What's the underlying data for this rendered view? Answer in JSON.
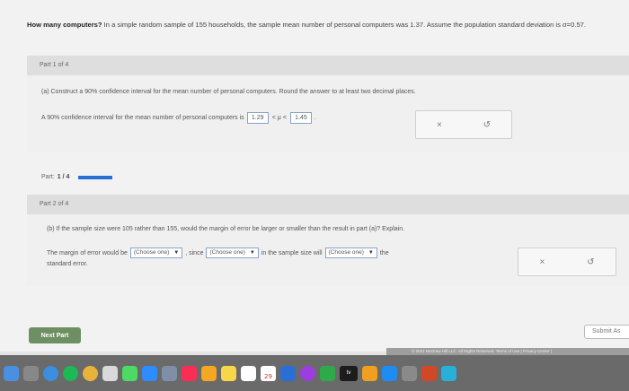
{
  "question": {
    "lead": "How many computers?",
    "body": " In a simple random sample of 155 households, the sample mean number of personal computers was 1.37. Assume the population standard deviation is σ=0.57."
  },
  "part1": {
    "header": "Part 1 of 4",
    "question": "(a) Construct a 90% confidence interval for the mean number of personal computers. Round the answer to at least two decimal places.",
    "answer_prefix": "A 90% confidence interval for the mean number of personal computers is",
    "lower": "1.29",
    "lt1": "<",
    "mu": "μ",
    "lt2": "<",
    "upper": "1.45",
    "period": "."
  },
  "tools": {
    "clear": "×",
    "undo": "↺"
  },
  "progress": {
    "label": "Part:",
    "value": "1 / 4",
    "fraction": 0.25
  },
  "part2": {
    "header": "Part 2 of 4",
    "question": "(b) If the sample size were 105 rather than 155, would the margin of error be larger or smaller than the result in part (a)? Explain.",
    "sentence_a": "The margin of error would be",
    "select1": "(Choose one)",
    "sentence_b": ", since",
    "select2": "(Choose one)",
    "sentence_c": "in the sample size will",
    "select3": "(Choose one)",
    "sentence_d": "the",
    "sentence_e": "standard error."
  },
  "buttons": {
    "next": "Next Part",
    "submit": "Submit As"
  },
  "footer": {
    "text": "© 2021 McGraw Hill LLC. All Rights Reserved.   Terms of Use  |  Privacy Center  |"
  },
  "dock": {
    "date": "29",
    "tv": "tv",
    "icons": [
      {
        "name": "finder-icon",
        "color": "#4a90e2"
      },
      {
        "name": "launchpad-icon",
        "color": "#888888"
      },
      {
        "name": "safari-icon",
        "color": "#3b8ee0"
      },
      {
        "name": "spotify-icon",
        "color": "#1db954"
      },
      {
        "name": "chrome-icon",
        "color": "#e8b33a"
      },
      {
        "name": "photos-icon",
        "color": "#d9d9d9"
      },
      {
        "name": "messages-icon",
        "color": "#4cd964"
      },
      {
        "name": "zoom-icon",
        "color": "#2d8cff"
      },
      {
        "name": "preview-icon",
        "color": "#7f8fa6"
      },
      {
        "name": "music-icon",
        "color": "#fa2d55"
      },
      {
        "name": "photos-app-icon",
        "color": "#f5a623"
      },
      {
        "name": "notes-icon",
        "color": "#f7d64a"
      },
      {
        "name": "reminders-icon",
        "color": "#ffffff"
      },
      {
        "name": "keynote-icon",
        "color": "#2b6fd6"
      },
      {
        "name": "podcasts-icon",
        "color": "#9b3de0"
      },
      {
        "name": "numbers-icon",
        "color": "#2eaa4a"
      },
      {
        "name": "pages-icon",
        "color": "#f0a020"
      },
      {
        "name": "appstore-icon",
        "color": "#1e8cf0"
      },
      {
        "name": "system-prefs-icon",
        "color": "#8a8a8a"
      },
      {
        "name": "powerpoint-icon",
        "color": "#d24726"
      },
      {
        "name": "edge-icon",
        "color": "#29b0d8"
      }
    ]
  }
}
